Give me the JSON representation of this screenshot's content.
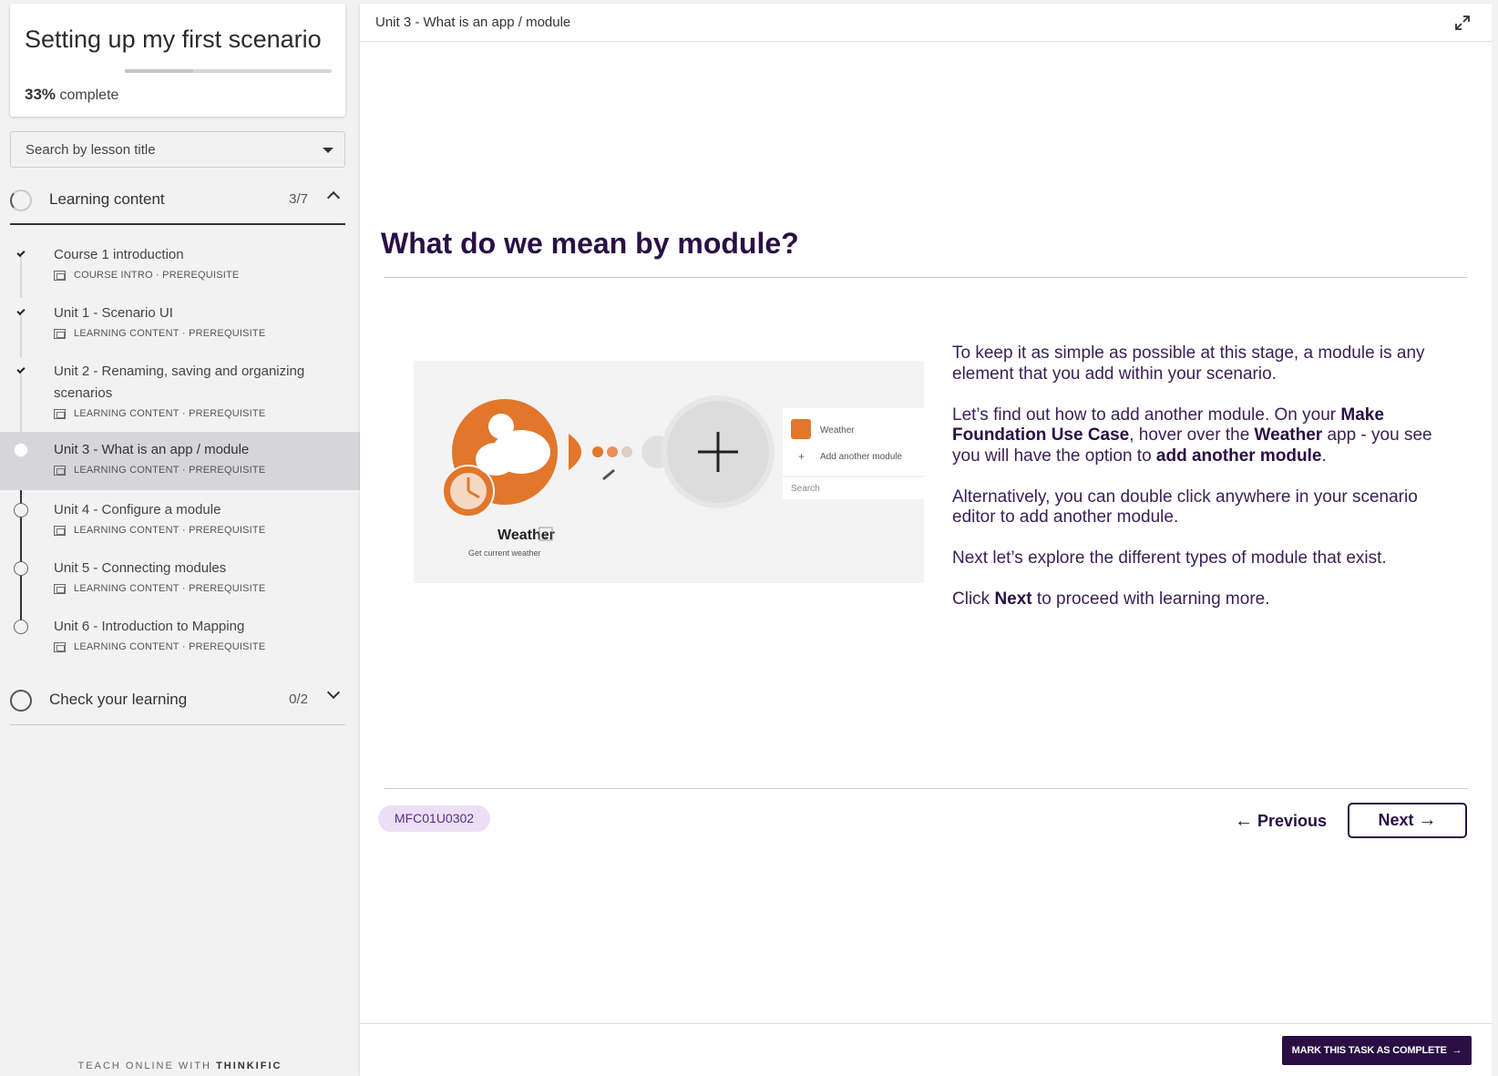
{
  "course": {
    "title": "Setting up my first scenario",
    "progress_percent": 33,
    "progress_pct_label": "33%",
    "progress_suffix": "complete"
  },
  "search": {
    "label": "Search by lesson title"
  },
  "chapters": [
    {
      "title": "Learning content",
      "count": "3/7",
      "expanded": true
    },
    {
      "title": "Check your learning",
      "count": "0/2",
      "expanded": false
    }
  ],
  "lessons": [
    {
      "title": "Course 1 introduction",
      "type": "COURSE INTRO",
      "tag": "PREREQUISITE",
      "state": "done"
    },
    {
      "title": "Unit 1 - Scenario UI",
      "type": "LEARNING CONTENT",
      "tag": "PREREQUISITE",
      "state": "done"
    },
    {
      "title": "Unit 2 - Renaming, saving and organizing scenarios",
      "type": "LEARNING CONTENT",
      "tag": "PREREQUISITE",
      "state": "done"
    },
    {
      "title": "Unit 3 - What is an app / module",
      "type": "LEARNING CONTENT",
      "tag": "PREREQUISITE",
      "state": "current"
    },
    {
      "title": "Unit 4 - Configure a module",
      "type": "LEARNING CONTENT",
      "tag": "PREREQUISITE",
      "state": "todo"
    },
    {
      "title": "Unit 5 - Connecting modules",
      "type": "LEARNING CONTENT",
      "tag": "PREREQUISITE",
      "state": "todo"
    },
    {
      "title": "Unit 6 - Introduction to Mapping",
      "type": "LEARNING CONTENT",
      "tag": "PREREQUISITE",
      "state": "todo"
    }
  ],
  "meta_separator": "·",
  "footer": {
    "prefix": "TEACH ONLINE WITH",
    "brand": "THINKIFIC"
  },
  "main": {
    "breadcrumb": "Unit 3 - What is an app / module",
    "heading": "What do we mean by module?",
    "illustration": {
      "app_name": "Weather",
      "app_index": "1",
      "app_subtitle": "Get current weather",
      "menu_item": "Weather",
      "menu_add": "Add another module",
      "menu_search": "Search"
    },
    "paragraphs": {
      "p1": "To keep it as simple as possible at this stage, a module is any element that you add within your scenario.",
      "p2_a": "Let’s find out how to add another module. On your ",
      "p2_b": "Make Foundation Use Case",
      "p2_c": ", hover over the ",
      "p2_d": "Weather",
      "p2_e": " app - you see you will have the option to ",
      "p2_f": "add another module",
      "p2_g": ".",
      "p3": "Alternatively, you can double click anywhere in your scenario editor to add another module.",
      "p4": "Next let’s explore the different types of module that exist.",
      "p5_a": "Click ",
      "p5_b": "Next",
      "p5_c": " to proceed with learning more."
    },
    "code": "MFC01U0302",
    "prev_label": "Previous",
    "next_label": "Next",
    "complete_label": "MARK THIS TASK AS COMPLETE"
  },
  "colors": {
    "brand": "#2a0f45",
    "pill_bg": "#ecdff5",
    "accent_orange": "#e2762b"
  },
  "icons": {
    "expand": "expand-icon",
    "prev_arrow": "arrow-left-icon",
    "next_arrow": "arrow-right-icon"
  }
}
